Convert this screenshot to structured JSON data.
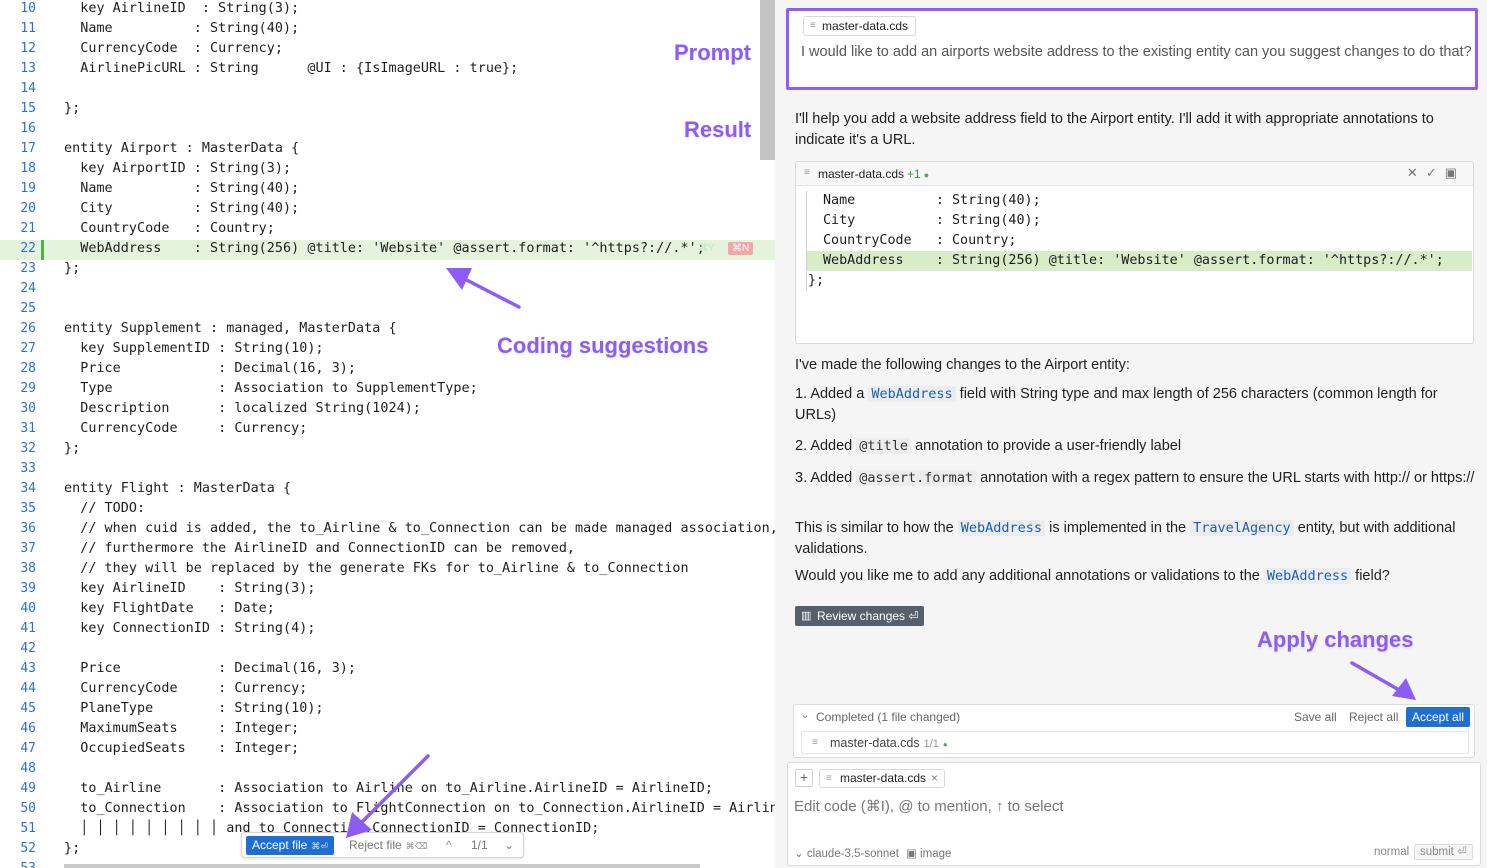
{
  "editor": {
    "lines": [
      {
        "n": "10",
        "code": "  key AirlineID  : String(3);"
      },
      {
        "n": "11",
        "code": "  Name          : String(40);"
      },
      {
        "n": "12",
        "code": "  CurrencyCode  : Currency;"
      },
      {
        "n": "13",
        "code": "  AirlinePicURL : String      @UI : {IsImageURL : true};"
      },
      {
        "n": "14",
        "code": ""
      },
      {
        "n": "15",
        "code": "};"
      },
      {
        "n": "16",
        "code": ""
      },
      {
        "n": "17",
        "code": "entity Airport : MasterData {"
      },
      {
        "n": "18",
        "code": "  key AirportID : String(3);"
      },
      {
        "n": "19",
        "code": "  Name          : String(40);"
      },
      {
        "n": "20",
        "code": "  City          : String(40);"
      },
      {
        "n": "21",
        "code": "  CountryCode   : Country;"
      },
      {
        "n": "22",
        "code": "  WebAddress    : String(256) @title: 'Website' @assert.format: '^https?://.*';"
      },
      {
        "n": "23",
        "code": "};"
      },
      {
        "n": "24",
        "code": ""
      },
      {
        "n": "25",
        "code": ""
      },
      {
        "n": "26",
        "code": "entity Supplement : managed, MasterData {"
      },
      {
        "n": "27",
        "code": "  key SupplementID : String(10);"
      },
      {
        "n": "28",
        "code": "  Price            : Decimal(16, 3);"
      },
      {
        "n": "29",
        "code": "  Type             : Association to SupplementType;"
      },
      {
        "n": "30",
        "code": "  Description      : localized String(1024);"
      },
      {
        "n": "31",
        "code": "  CurrencyCode     : Currency;"
      },
      {
        "n": "32",
        "code": "};"
      },
      {
        "n": "33",
        "code": ""
      },
      {
        "n": "34",
        "code": "entity Flight : MasterData {"
      },
      {
        "n": "35",
        "code": "  // TODO:"
      },
      {
        "n": "36",
        "code": "  // when cuid is added, the to_Airline & to_Connection can be made managed association,"
      },
      {
        "n": "37",
        "code": "  // furthermore the AirlineID and ConnectionID can be removed,"
      },
      {
        "n": "38",
        "code": "  // they will be replaced by the generate FKs for to_Airline & to_Connection"
      },
      {
        "n": "39",
        "code": "  key AirlineID    : String(3);"
      },
      {
        "n": "40",
        "code": "  key FlightDate   : Date;"
      },
      {
        "n": "41",
        "code": "  key ConnectionID : String(4);"
      },
      {
        "n": "42",
        "code": ""
      },
      {
        "n": "43",
        "code": "  Price            : Decimal(16, 3);"
      },
      {
        "n": "44",
        "code": "  CurrencyCode     : Currency;"
      },
      {
        "n": "45",
        "code": "  PlaneType        : String(10);"
      },
      {
        "n": "46",
        "code": "  MaximumSeats     : Integer;"
      },
      {
        "n": "47",
        "code": "  OccupiedSeats    : Integer;"
      },
      {
        "n": "48",
        "code": ""
      },
      {
        "n": "49",
        "code": "  to_Airline       : Association to Airline on to_Airline.AirlineID = AirlineID;"
      },
      {
        "n": "50",
        "code": "  to_Connection    : Association to FlightConnection on to_Connection.AirlineID = AirlineID"
      },
      {
        "n": "51",
        "code": "  │ │ │ │ │ │ │ │ │ and to_Connection.ConnectionID = ConnectionID;"
      },
      {
        "n": "52",
        "code": "};"
      },
      {
        "n": "53",
        "code": ""
      }
    ],
    "inline_accept_hint": "⌘Y",
    "inline_reject_hint": "⌘N",
    "float_bar": {
      "accept": "Accept file",
      "accept_kbd": "⌘⏎",
      "reject": "Reject file",
      "reject_kbd": "⌘⌫",
      "up": "^",
      "count": "1/1",
      "down": "⌄"
    }
  },
  "annotations": {
    "prompt": "Prompt",
    "result": "Result",
    "coding": "Coding suggestions",
    "apply": "Apply changes"
  },
  "chat": {
    "prompt_chip": "master-data.cds",
    "prompt_text": "I would like to add an airports website address to the existing entity can you suggest changes to do that?",
    "intro": "I'll help you add a website address field to the Airport entity. I'll add it with appropriate annotations to indicate it's a URL.",
    "code_block": {
      "filename": "master-data.cds",
      "plus": "+1",
      "icons": "✕✓▣",
      "lines": [
        "Name          : String(40);",
        "City          : String(40);",
        "CountryCode   : Country;",
        "WebAddress    : String(256) @title: 'Website' @assert.format: '^https?://.*';",
        "};"
      ]
    },
    "changes_intro": "I've made the following changes to the Airport entity:",
    "item1_pre": "1. Added a ",
    "item1_code": "WebAddress",
    "item1_post": " field with String type and max length of 256 characters (common length for URLs)",
    "item2_pre": "2. Added ",
    "item2_code": "@title",
    "item2_post": " annotation to provide a user-friendly label",
    "item3_pre": "3. Added ",
    "item3_code": "@assert.format",
    "item3_post": " annotation with a regex pattern to ensure the URL starts with http:// or https://",
    "similar_pre": "This is similar to how the ",
    "similar_code1": "WebAddress",
    "similar_mid": " is implemented in the ",
    "similar_code2": "TravelAgency",
    "similar_post": " entity, but with additional validations.",
    "question_pre": "Would you like me to add any additional annotations or validations to the ",
    "question_code": "WebAddress",
    "question_post": " field?",
    "review_button": "Review changes ⏎",
    "completed": {
      "label": "Completed  (1 file changed)",
      "save_all": "Save all",
      "reject_all": "Reject all",
      "accept_all": "Accept all",
      "file": "master-data.cds",
      "file_count": "1/1"
    },
    "input": {
      "chip": "master-data.cds",
      "placeholder": "Edit code (⌘I), @ to mention, ↑ to select",
      "model": "⌄ claude-3.5-sonnet",
      "image": "▣ image",
      "mode": "normal",
      "submit": "submit ⏎"
    }
  },
  "colors": {
    "accent_purple": "#8f5cf6",
    "primary_blue": "#1f6fd0",
    "added_line_green": "#e4f4dc"
  }
}
